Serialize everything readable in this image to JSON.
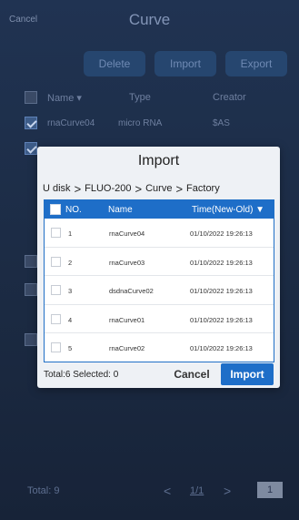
{
  "topbar": {
    "cancel_label": "Cancel",
    "title": "Curve"
  },
  "actions": {
    "delete_label": "Delete",
    "import_label": "Import",
    "export_label": "Export"
  },
  "background_table": {
    "headers": {
      "name": "Name ▾",
      "type": "Type",
      "creator": "Creator"
    },
    "rows": [
      {
        "name": "rnaCurve04",
        "type": "micro RNA",
        "creator": "$AS",
        "checked": true
      }
    ]
  },
  "footer": {
    "total": "Total: 9",
    "prev": "<",
    "page": "1/1",
    "next": ">",
    "page_box": "1"
  },
  "dialog": {
    "title": "Import",
    "breadcrumb": [
      "U disk",
      "FLUO-200",
      "Curve",
      "Factory"
    ],
    "breadcrumb_sep": ">",
    "headers": {
      "no": "NO.",
      "name": "Name",
      "time": "Time(New-Old) ▼"
    },
    "rows": [
      {
        "no": "1",
        "name": "rnaCurve04",
        "time": "01/10/2022 19:26:13"
      },
      {
        "no": "2",
        "name": "rnaCurve03",
        "time": "01/10/2022 19:26:13"
      },
      {
        "no": "3",
        "name": "dsdnaCurve02",
        "time": "01/10/2022 19:26:13"
      },
      {
        "no": "4",
        "name": "rnaCurve01",
        "time": "01/10/2022 19:26:13"
      },
      {
        "no": "5",
        "name": "rnaCurve02",
        "time": "01/10/2022 19:26:13"
      }
    ],
    "summary": "Total:6  Selected: 0",
    "cancel_label": "Cancel",
    "import_label": "Import"
  },
  "colors": {
    "accent": "#1e6ec8",
    "background": "#1d2c44"
  }
}
